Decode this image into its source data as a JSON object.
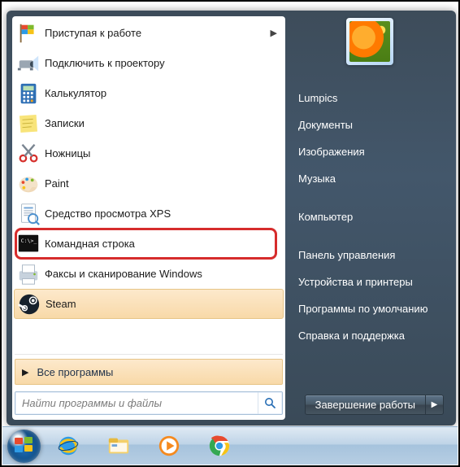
{
  "programs": [
    {
      "name": "getting-started",
      "label": "Приступая к работе",
      "has_submenu": true,
      "icon": "flag"
    },
    {
      "name": "connect-projector",
      "label": "Подключить к проектору",
      "icon": "projector"
    },
    {
      "name": "calculator",
      "label": "Калькулятор",
      "icon": "calc"
    },
    {
      "name": "sticky-notes",
      "label": "Записки",
      "icon": "notes"
    },
    {
      "name": "snipping-tool",
      "label": "Ножницы",
      "icon": "scissors"
    },
    {
      "name": "paint",
      "label": "Paint",
      "icon": "paint"
    },
    {
      "name": "xps-viewer",
      "label": "Средство просмотра XPS",
      "icon": "xps"
    },
    {
      "name": "command-prompt",
      "label": "Командная строка",
      "icon": "cmd",
      "highlight": true
    },
    {
      "name": "fax-scan",
      "label": "Факсы и сканирование Windows",
      "icon": "fax"
    },
    {
      "name": "steam",
      "label": "Steam",
      "icon": "steam",
      "accent": true
    }
  ],
  "all_programs": "Все программы",
  "search_placeholder": "Найти программы и файлы",
  "right_links": [
    {
      "name": "user",
      "label": "Lumpics"
    },
    {
      "name": "documents",
      "label": "Документы"
    },
    {
      "name": "pictures",
      "label": "Изображения"
    },
    {
      "name": "music",
      "label": "Музыка"
    },
    {
      "name": "computer",
      "label": "Компьютер",
      "gap": true
    },
    {
      "name": "control-panel",
      "label": "Панель управления",
      "gap": true
    },
    {
      "name": "devices",
      "label": "Устройства и принтеры"
    },
    {
      "name": "default-programs",
      "label": "Программы по умолчанию"
    },
    {
      "name": "help",
      "label": "Справка и поддержка"
    }
  ],
  "shutdown_label": "Завершение работы"
}
